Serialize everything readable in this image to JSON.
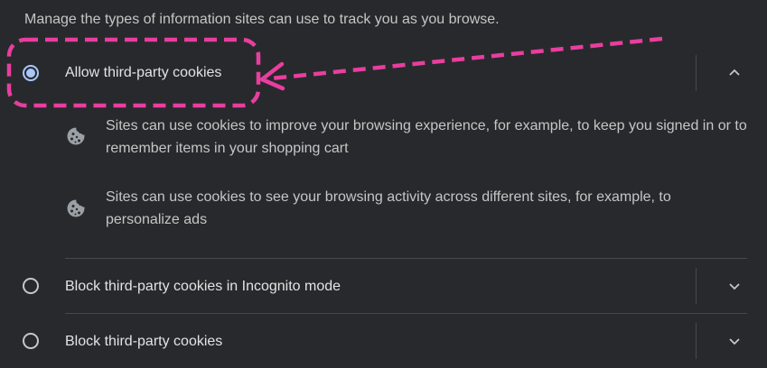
{
  "intro": "Manage the types of information sites can use to track you as you browse.",
  "options": [
    {
      "label": "Allow third-party cookies",
      "selected": true,
      "expanded": true,
      "chevron": "chevron-up-icon",
      "details": [
        {
          "icon": "cookie-icon",
          "text": "Sites can use cookies to improve your browsing experience, for example, to keep you signed in or to remember items in your shopping cart"
        },
        {
          "icon": "cookie-icon",
          "text": "Sites can use cookies to see your browsing activity across different sites, for example, to personalize ads"
        }
      ]
    },
    {
      "label": "Block third-party cookies in Incognito mode",
      "selected": false,
      "expanded": false,
      "chevron": "chevron-down-icon"
    },
    {
      "label": "Block third-party cookies",
      "selected": false,
      "expanded": false,
      "chevron": "chevron-down-icon"
    }
  ],
  "colors": {
    "background": "#28292c",
    "text": "#e3e3e3",
    "secondary_text": "#c4c7c5",
    "radio_selected": "#a8c7fa",
    "divider": "#47484a",
    "annotation": "#e83e9f"
  },
  "annotation": {
    "type": "dashed highlight box with arrow",
    "target": "allow-third-party-cookies option"
  }
}
